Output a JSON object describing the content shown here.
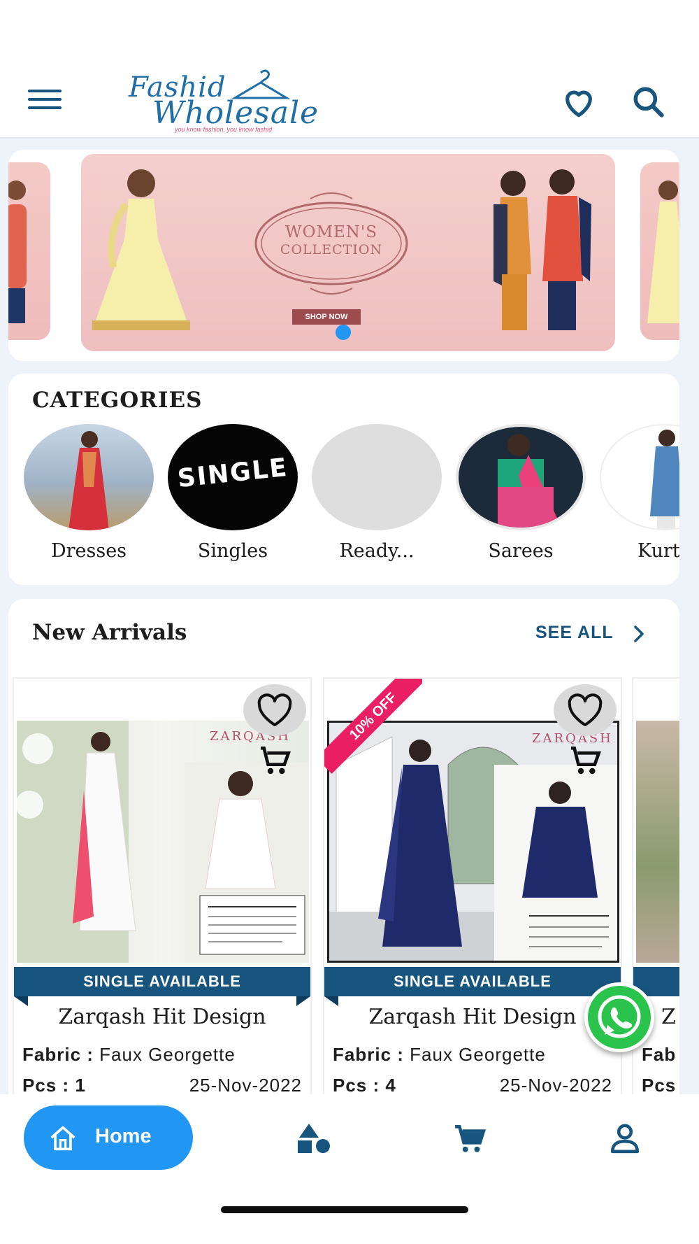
{
  "header": {
    "logo_line1": "Fashid",
    "logo_line2": "Wholesale",
    "logo_tagline": "you know fashion, you know fashid"
  },
  "banner": {
    "title_line1": "WOMEN'S",
    "title_line2": "COLLECTION",
    "cta": "SHOP NOW",
    "active_slide": 1
  },
  "categories": {
    "title": "CATEGORIES",
    "items": [
      {
        "label": "Dresses"
      },
      {
        "label": "Singles",
        "image_text": "SINGLE"
      },
      {
        "label": "Ready..."
      },
      {
        "label": "Sarees"
      },
      {
        "label": "Kurt"
      }
    ]
  },
  "new_arrivals": {
    "title": "New Arrivals",
    "see_all": "SEE ALL",
    "products": [
      {
        "name": "Zarqash Hit Design",
        "fabric_label": "Fabric :",
        "fabric": "Faux Georgette",
        "pcs": "Pcs : 1",
        "date": "25-Nov-2022",
        "tag": "SINGLE AVAILABLE",
        "brand": "ZARQASH",
        "discount": ""
      },
      {
        "name": "Zarqash Hit Design",
        "fabric_label": "Fabric :",
        "fabric": "Faux Georgette",
        "pcs": "Pcs : 4",
        "date": "25-Nov-2022",
        "tag": "SINGLE AVAILABLE",
        "brand": "ZARQASH",
        "discount": "10% OFF"
      },
      {
        "name": "Z",
        "fabric_label": "Fab",
        "pcs": "Pcs"
      }
    ]
  },
  "bottom_nav": {
    "home_label": "Home",
    "items": [
      "home-icon",
      "categories-icon",
      "cart-icon",
      "profile-icon"
    ]
  },
  "colors": {
    "primary": "#17557f",
    "accent_blue": "#2196f3",
    "discount_pink": "#e91e63",
    "whatsapp_green": "#2ac34b"
  }
}
